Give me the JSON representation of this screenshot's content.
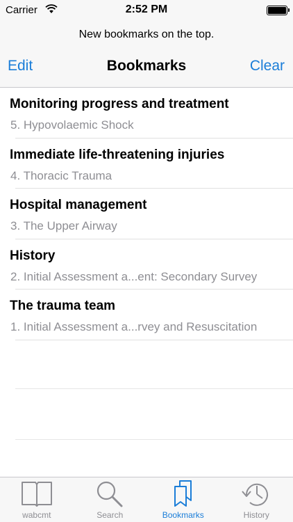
{
  "status_bar": {
    "carrier": "Carrier",
    "time": "2:52 PM",
    "battery_level": 1.0
  },
  "header": {
    "prompt": "New bookmarks on the top.",
    "edit_label": "Edit",
    "title": "Bookmarks",
    "clear_label": "Clear"
  },
  "bookmarks": [
    {
      "title": "Monitoring progress and treatment",
      "subtitle": "5. Hypovolaemic Shock"
    },
    {
      "title": "Immediate life-threatening injuries",
      "subtitle": "4. Thoracic Trauma"
    },
    {
      "title": "Hospital management",
      "subtitle": "3. The Upper Airway"
    },
    {
      "title": "History",
      "subtitle": "2. Initial Assessment a...ent: Secondary Survey"
    },
    {
      "title": "The trauma team",
      "subtitle": "1. Initial Assessment a...rvey and Resuscitation"
    }
  ],
  "tabs": [
    {
      "label": "wabcmt",
      "icon": "book-icon",
      "active": false
    },
    {
      "label": "Search",
      "icon": "search-icon",
      "active": false
    },
    {
      "label": "Bookmarks",
      "icon": "bookmarks-icon",
      "active": true
    },
    {
      "label": "History",
      "icon": "history-clock-icon",
      "active": false
    }
  ],
  "colors": {
    "accent": "#1a7dd8",
    "inactive": "#8e8e93",
    "bar_background": "#f7f7f7"
  }
}
